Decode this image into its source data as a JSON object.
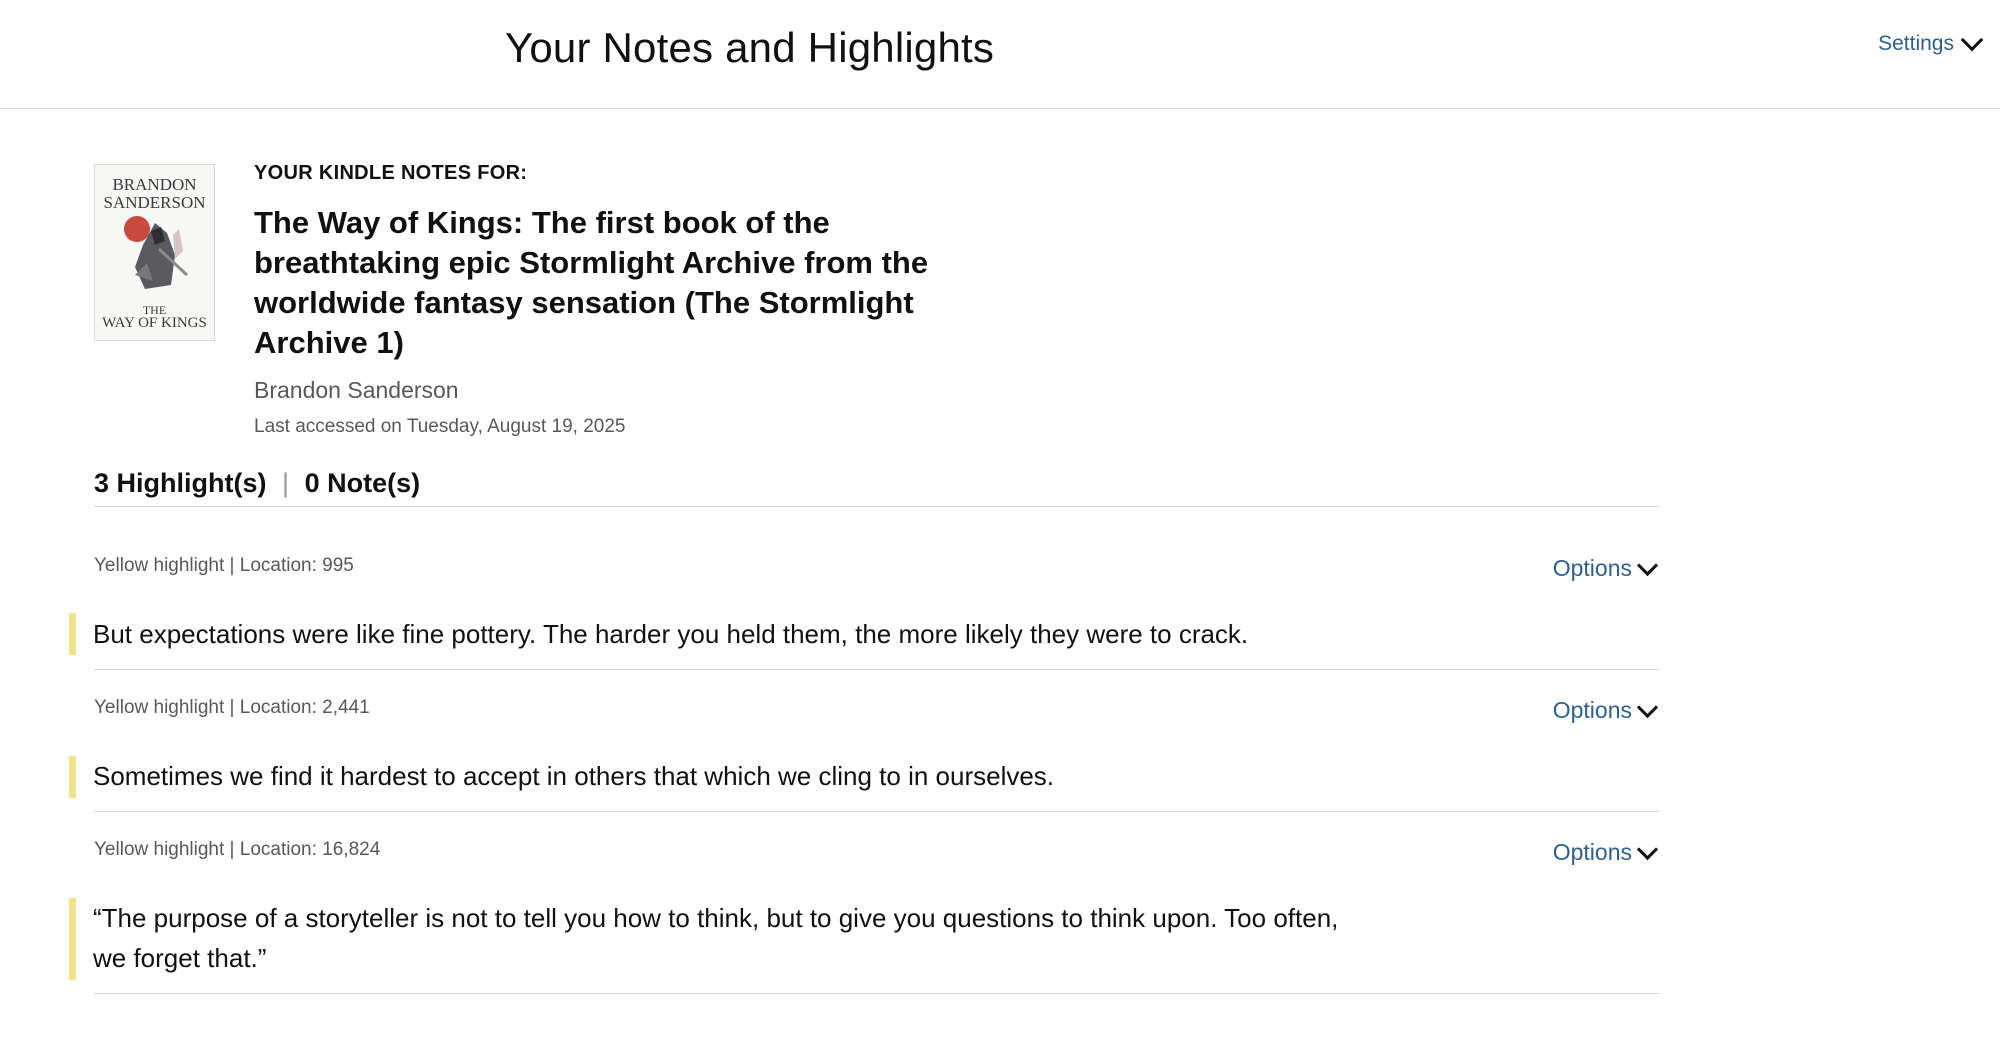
{
  "header": {
    "title": "Your Notes and Highlights",
    "settings_label": "Settings"
  },
  "book": {
    "kicker": "YOUR KINDLE NOTES FOR:",
    "title": "The Way of Kings: The first book of the breathtaking epic Stormlight Archive from the worldwide fantasy sensation (The Stormlight Archive 1)",
    "author": "Brandon Sanderson",
    "last_accessed_label": "Last accessed on",
    "last_accessed_date": "Tuesday, August 19, 2025",
    "cover_author_line1": "BRANDON",
    "cover_author_line2": "SANDERSON",
    "cover_title_line1": "THE",
    "cover_title_line2": "WAY OF KINGS"
  },
  "counts": {
    "highlights_count": "3",
    "highlights_label": "Highlight(s)",
    "separator": "|",
    "notes_count": "0",
    "notes_label": "Note(s)"
  },
  "highlights": [
    {
      "meta": "Yellow highlight | Location: 995",
      "options_label": "Options",
      "text": "But expectations were like fine pottery. The harder you held them, the more likely they were to crack."
    },
    {
      "meta": "Yellow highlight | Location: 2,441",
      "options_label": "Options",
      "text": "Sometimes we find it hardest to accept in others that which we cling to in ourselves."
    },
    {
      "meta": "Yellow highlight | Location: 16,824",
      "options_label": "Options",
      "text": "“The purpose of a storyteller is not to tell you how to think, but to give you questions to think upon. Too often, we forget that.”"
    }
  ],
  "colors": {
    "link": "#2e5f8f",
    "highlight_bar": "#f2e38a",
    "divider": "#d5d9d9",
    "muted_text": "#565959"
  },
  "icons": {
    "settings": "chevron-down-icon",
    "options": "chevron-down-icon"
  }
}
